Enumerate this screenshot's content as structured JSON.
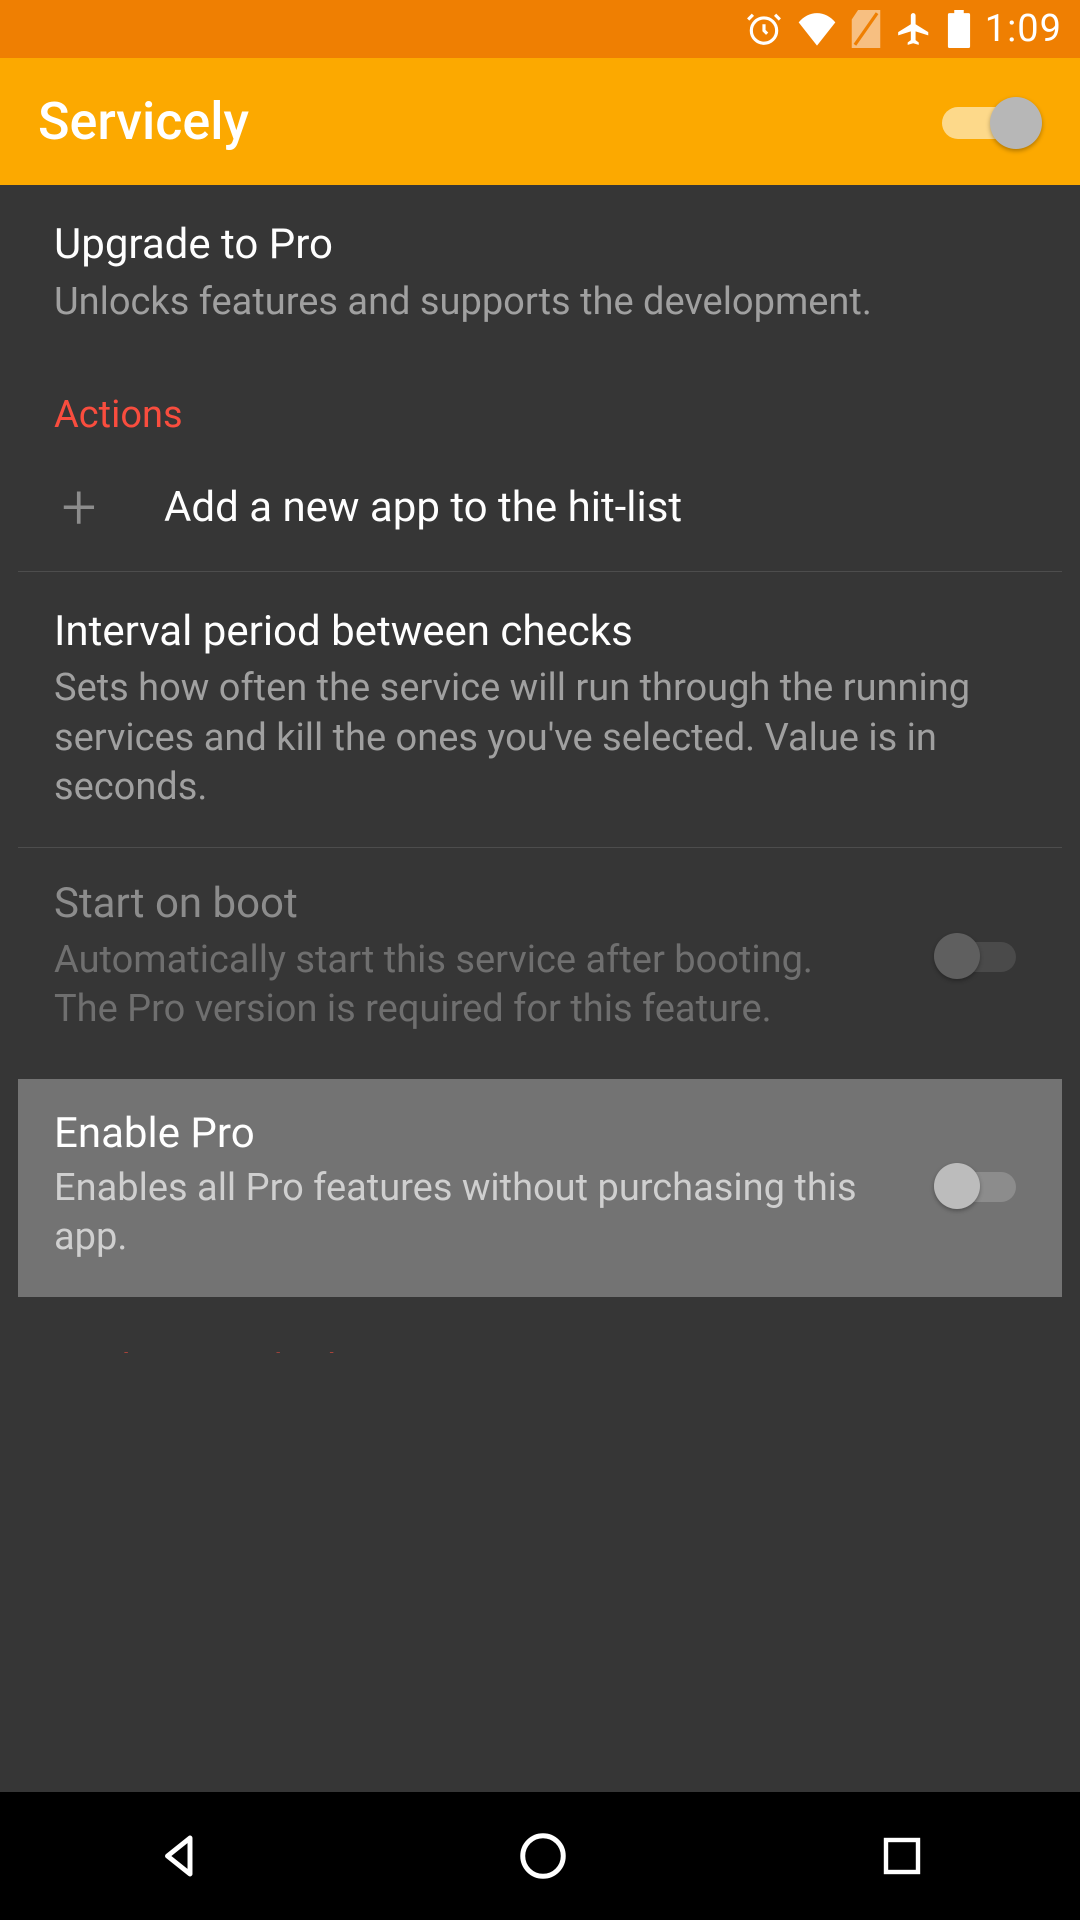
{
  "status": {
    "time": "1:09"
  },
  "appbar": {
    "title": "Servicely"
  },
  "items": {
    "upgrade": {
      "title": "Upgrade to Pro",
      "subtitle": "Unlocks features and supports the development."
    },
    "actions_header": "Actions",
    "add_app": "Add a new app to the hit-list",
    "interval": {
      "title": "Interval period between checks",
      "subtitle": "Sets how often the service will run through the running services and kill the ones you've selected. Value is in seconds."
    },
    "start_on_boot": {
      "title": "Start on boot",
      "subtitle": "Automatically start this service after booting.\nThe Pro version is required for this feature."
    },
    "enable_pro": {
      "title": "Enable Pro",
      "subtitle": "Enables all Pro features without purchasing this app."
    },
    "hitlist_header": "Applications hit-list"
  }
}
